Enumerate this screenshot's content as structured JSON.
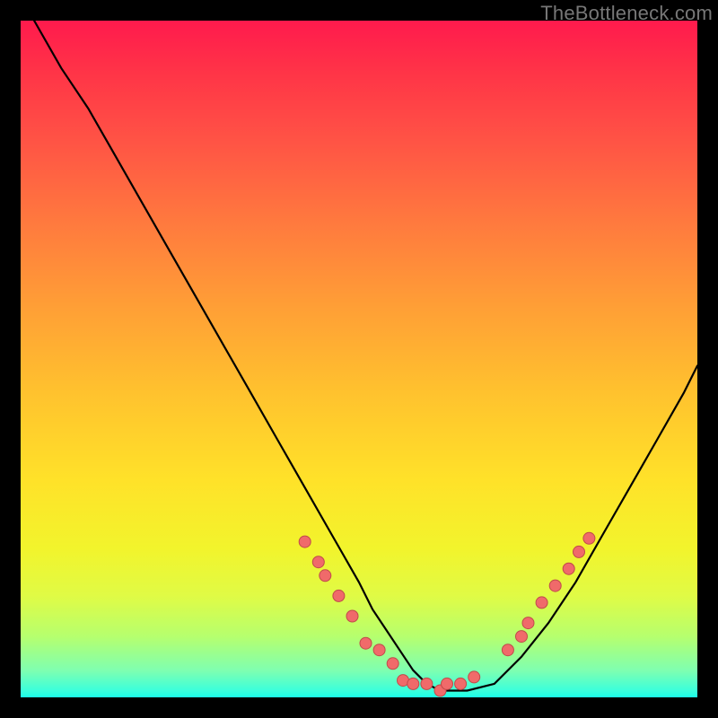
{
  "watermark": "TheBottleneck.com",
  "colors": {
    "background": "#000000",
    "curve": "#000000",
    "dot_fill": "#f06a6a",
    "dot_stroke": "#c04a4a"
  },
  "chart_data": {
    "type": "line",
    "title": "",
    "xlabel": "",
    "ylabel": "",
    "xlim": [
      0,
      100
    ],
    "ylim": [
      0,
      100
    ],
    "series": [
      {
        "name": "curve",
        "x": [
          2,
          6,
          10,
          14,
          18,
          22,
          26,
          30,
          34,
          38,
          42,
          46,
          50,
          52,
          54,
          56,
          58,
          60,
          62,
          66,
          70,
          74,
          78,
          82,
          86,
          90,
          94,
          98,
          100
        ],
        "y": [
          100,
          93,
          87,
          80,
          73,
          66,
          59,
          52,
          45,
          38,
          31,
          24,
          17,
          13,
          10,
          7,
          4,
          2,
          1,
          1,
          2,
          6,
          11,
          17,
          24,
          31,
          38,
          45,
          49
        ]
      }
    ],
    "dots": [
      {
        "x": 42,
        "y": 23
      },
      {
        "x": 44,
        "y": 20
      },
      {
        "x": 45,
        "y": 18
      },
      {
        "x": 47,
        "y": 15
      },
      {
        "x": 49,
        "y": 12
      },
      {
        "x": 51,
        "y": 8
      },
      {
        "x": 53,
        "y": 7
      },
      {
        "x": 55,
        "y": 5
      },
      {
        "x": 56.5,
        "y": 2.5
      },
      {
        "x": 58,
        "y": 2
      },
      {
        "x": 60,
        "y": 2
      },
      {
        "x": 62,
        "y": 1
      },
      {
        "x": 63,
        "y": 2
      },
      {
        "x": 65,
        "y": 2
      },
      {
        "x": 67,
        "y": 3
      },
      {
        "x": 72,
        "y": 7
      },
      {
        "x": 74,
        "y": 9
      },
      {
        "x": 75,
        "y": 11
      },
      {
        "x": 77,
        "y": 14
      },
      {
        "x": 79,
        "y": 16.5
      },
      {
        "x": 81,
        "y": 19
      },
      {
        "x": 82.5,
        "y": 21.5
      },
      {
        "x": 84,
        "y": 23.5
      }
    ]
  }
}
